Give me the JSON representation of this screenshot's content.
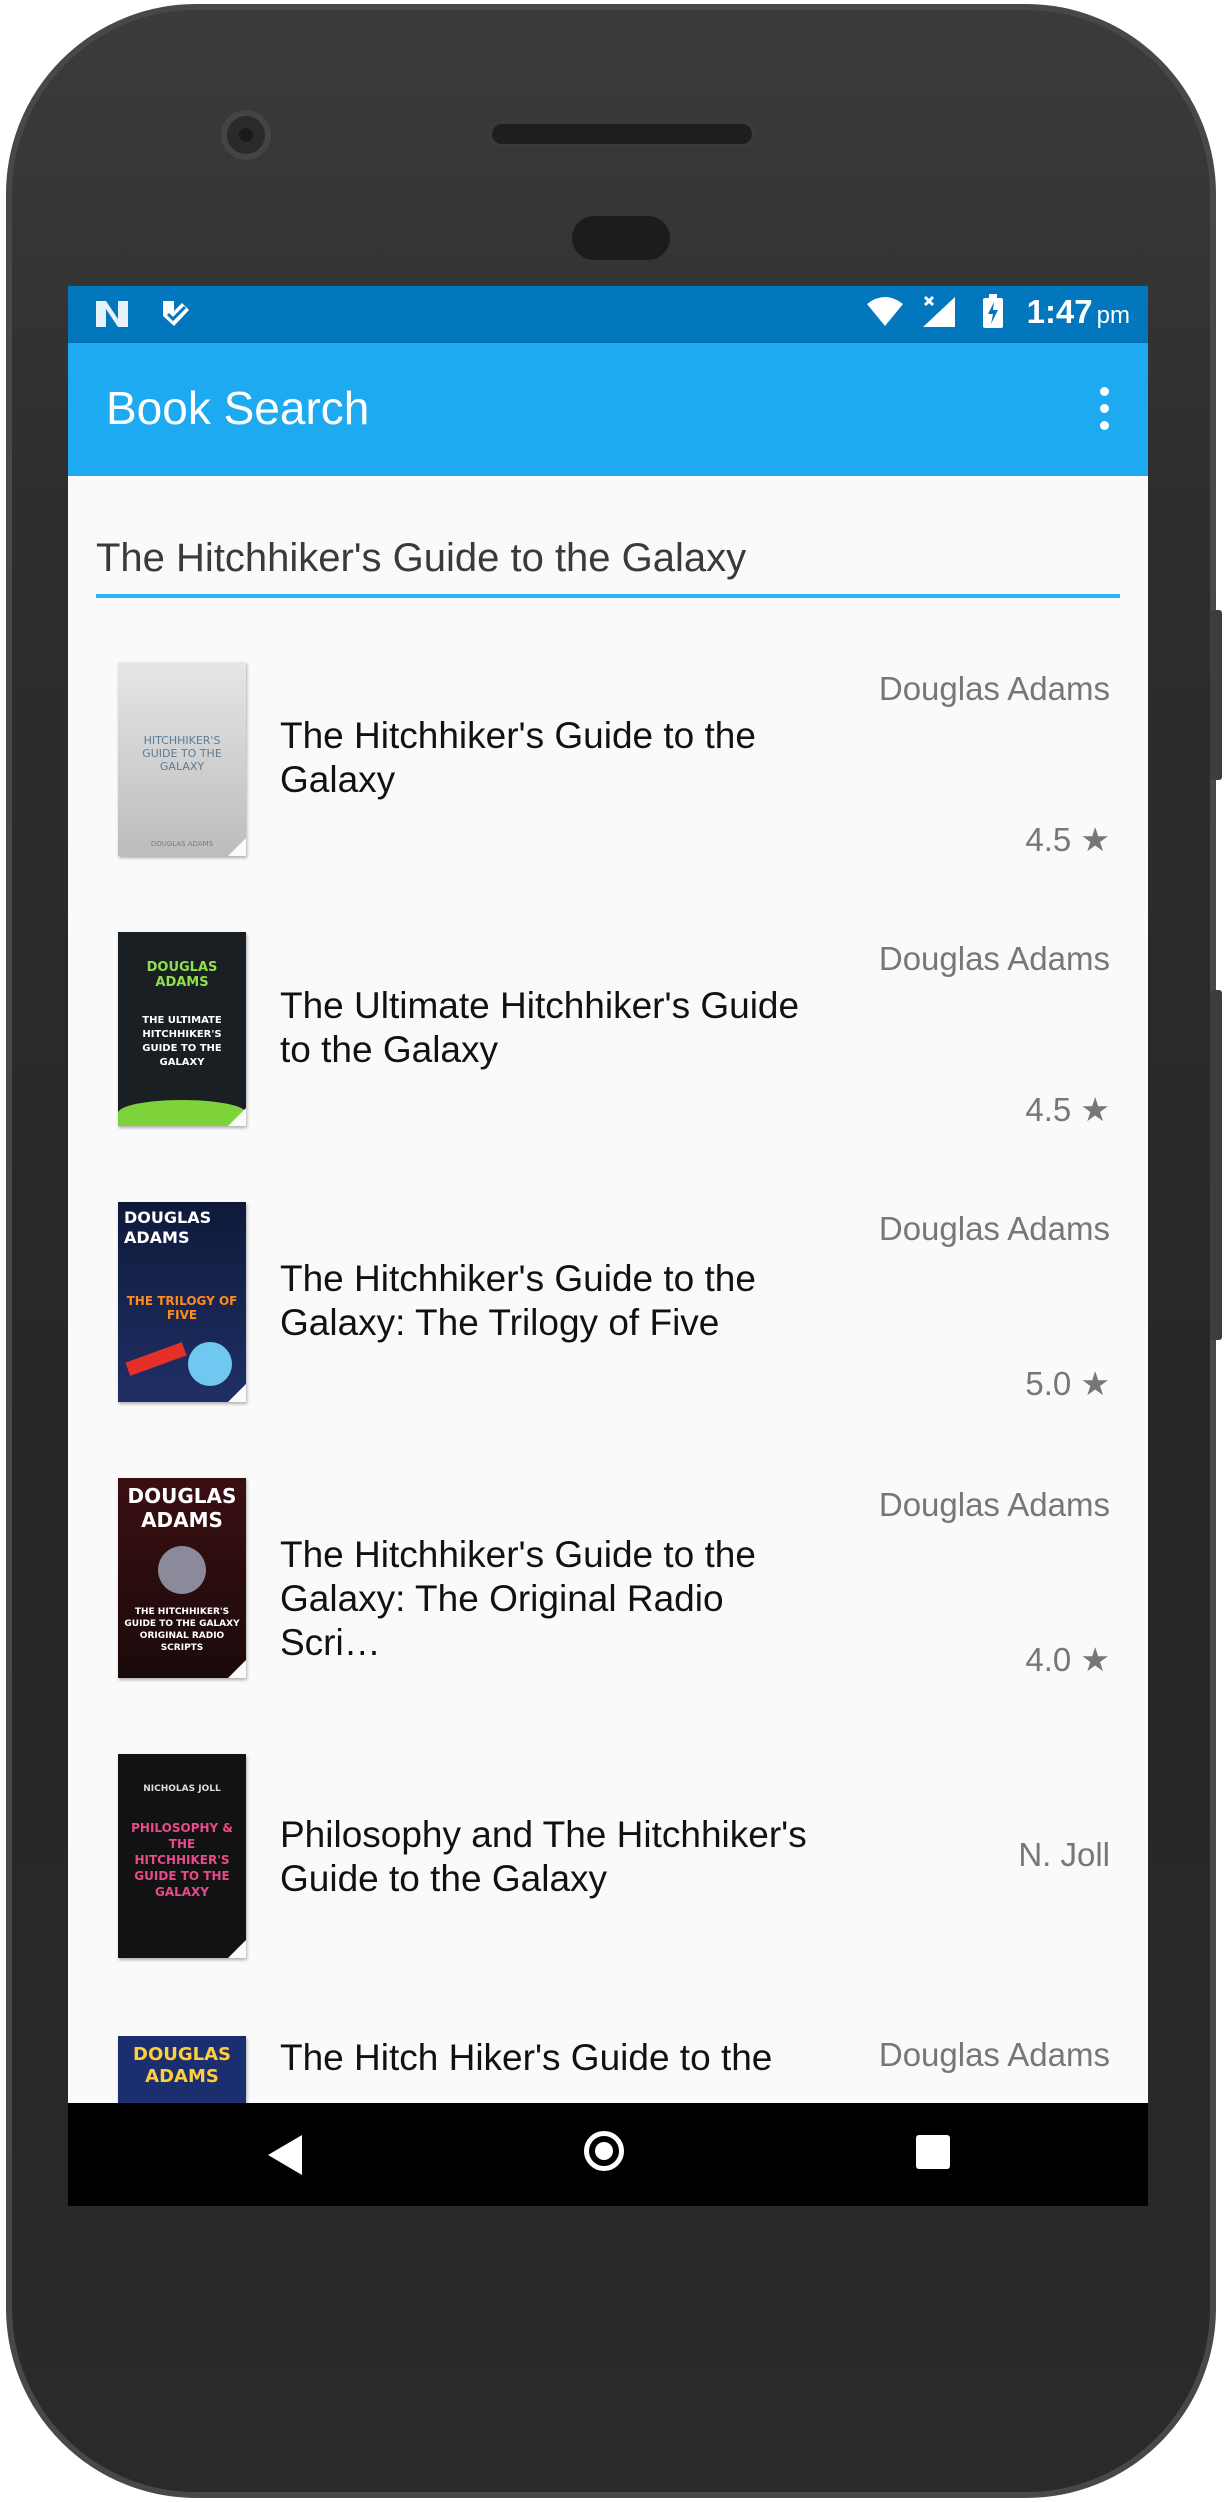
{
  "status_bar": {
    "time": "1:47",
    "ampm": "pm",
    "left_icons": [
      "n-logo-icon",
      "checkmark-app-icon"
    ],
    "right_icons": [
      "wifi-icon",
      "signal-icon",
      "battery-charging-icon"
    ]
  },
  "app_bar": {
    "title": "Book Search",
    "menu_icon": "overflow-menu-icon"
  },
  "search": {
    "value": "The Hitchhiker's Guide to the Galaxy"
  },
  "books": [
    {
      "title": "The Hitchhiker's Guide to the Galaxy",
      "title_line1": "The Hitchhiker's Guide to the",
      "title_line2": "Galaxy",
      "author": "Douglas Adams",
      "rating": "4.5 ★",
      "cover_text": "HITCHHIKER'S GUIDE TO THE GALAXY",
      "cover_bottom": "DOUGLAS ADAMS",
      "cover_color": "#d8d8d8"
    },
    {
      "title": "The Ultimate Hitchhiker's Guide to the Galaxy",
      "title_line1": "The Ultimate Hitchhiker's Guide",
      "title_line2": "to the Galaxy",
      "author": "Douglas Adams",
      "rating": "4.5 ★",
      "cover_text": "DOUGLAS ADAMS",
      "cover_bottom": "THE ULTIMATE HITCHHIKER'S GUIDE TO THE GALAXY",
      "cover_color": "#1a1f24"
    },
    {
      "title": "The Hitchhiker's Guide to the Galaxy: The Trilogy of Five",
      "title_line1": "The Hitchhiker's Guide to the",
      "title_line2": "Galaxy: The Trilogy of Five",
      "author": "Douglas Adams",
      "rating": "5.0 ★",
      "cover_text": "DOUGLAS ADAMS",
      "cover_bottom": "THE TRILOGY OF FIVE",
      "cover_color": "#0f1a3a"
    },
    {
      "title": "The Hitchhiker's Guide to the Galaxy: The Original Radio Scripts",
      "title_line1": "The Hitchhiker's Guide to the",
      "title_line2": "Galaxy: The Original Radio Scri…",
      "author": "Douglas Adams",
      "rating": "4.0 ★",
      "cover_text": "DOUGLAS ADAMS",
      "cover_bottom": "THE HITCHHIKER'S GUIDE TO THE GALAXY ORIGINAL RADIO SCRIPTS",
      "cover_color": "#2a0f10"
    },
    {
      "title": "Philosophy and The Hitchhiker's Guide to the Galaxy",
      "title_line1": "Philosophy and The Hitchhiker's",
      "title_line2": "Guide to the Galaxy",
      "author": "N. Joll",
      "rating": "",
      "cover_text": "NICHOLAS JOLL",
      "cover_bottom": "PHILOSOPHY & THE HITCHHIKER'S GUIDE TO THE GALAXY",
      "cover_color": "#121212"
    },
    {
      "title": "The Hitch Hiker's Guide to the",
      "title_line1": "The Hitch Hiker's Guide to the",
      "title_line2": "",
      "author": "Douglas Adams",
      "rating": "",
      "cover_text": "DOUGLAS ADAMS",
      "cover_bottom": "",
      "cover_color": "#1b2f6e"
    }
  ],
  "nav_bar": {
    "buttons": [
      "back-icon",
      "home-icon",
      "recents-icon"
    ]
  },
  "colors": {
    "status_bar": "#0277bd",
    "app_bar": "#1eaaf1",
    "accent": "#29b6f6",
    "list_bg": "#fafafa"
  }
}
